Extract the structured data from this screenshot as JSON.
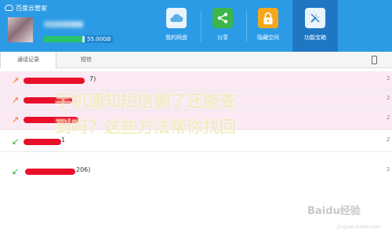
{
  "app": {
    "title": "百度云管家"
  },
  "user": {
    "storage_used_fraction": 0.95,
    "storage_text": "55.00GB"
  },
  "nav": [
    {
      "label": "我的网盘",
      "icon": "cloud-icon",
      "color": "#5aaee8"
    },
    {
      "label": "分享",
      "icon": "share-icon",
      "color": "#3cb64a"
    },
    {
      "label": "隐藏空间",
      "icon": "lock-icon",
      "color": "#f5a81c"
    },
    {
      "label": "功能宝箱",
      "icon": "tools-icon",
      "color": "#5aaee8",
      "active": true
    }
  ],
  "tabs": [
    {
      "label": "通话记录",
      "active": true
    },
    {
      "label": "短信",
      "active": false
    }
  ],
  "tab_right_text": "",
  "calls": [
    {
      "type": "outgoing",
      "suffix": "7)",
      "highlight": true,
      "count": "2"
    },
    {
      "type": "outgoing",
      "suffix": "",
      "highlight": true,
      "count": "2"
    },
    {
      "type": "outgoing",
      "suffix": "",
      "highlight": true,
      "count": "2"
    },
    {
      "type": "incoming",
      "suffix": "1",
      "highlight": false,
      "count": "2"
    },
    {
      "type": "incoming",
      "suffix": "206)",
      "highlight": false,
      "count": "2"
    }
  ],
  "overlay_title": {
    "line1": "手机通知短信删了还能查",
    "line2": "到吗？这些方法帮你找回"
  },
  "watermark": {
    "brand": "Baidu经验",
    "url": "jingyan.baidu.com"
  },
  "colors": {
    "header": "#2b9be6",
    "active_nav": "#1f77c4",
    "redaction": "#e8102a",
    "highlight_row": "#fbe9f3"
  }
}
